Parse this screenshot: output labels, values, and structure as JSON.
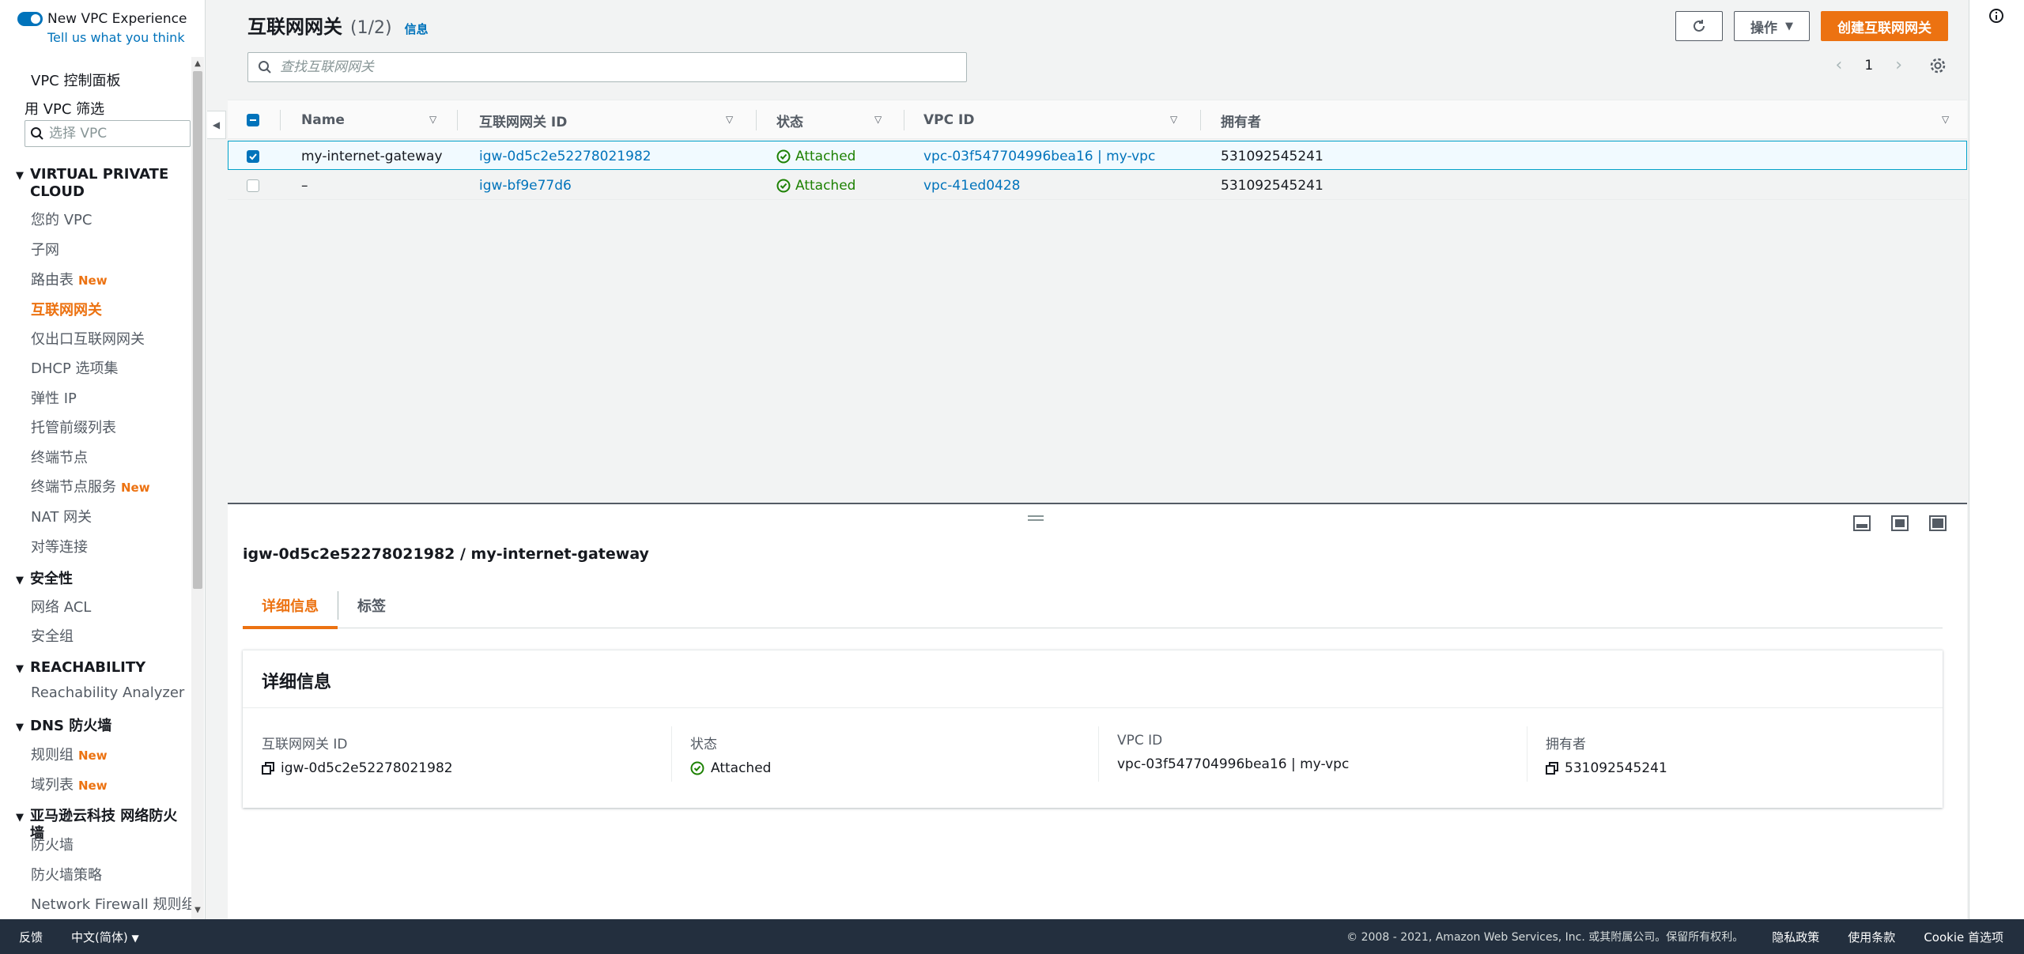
{
  "sidebar": {
    "experience_label": "New VPC Experience",
    "feedback_link": "Tell us what you think",
    "dashboard": "VPC 控制面板",
    "filter_label": "用 VPC 筛选",
    "filter_placeholder": "选择 VPC",
    "sections": {
      "vpc": "VIRTUAL PRIVATE CLOUD",
      "security": "安全性",
      "reachability": "REACHABILITY",
      "dns_firewall": "DNS 防火墙",
      "network_firewall": "亚马逊云科技 网络防火墙"
    },
    "items": {
      "your_vpcs": "您的 VPC",
      "subnets": "子网",
      "route_tables": "路由表",
      "internet_gateways": "互联网网关",
      "egress_only_gateways": "仅出口互联网网关",
      "dhcp_options": "DHCP 选项集",
      "elastic_ip": "弹性 IP",
      "prefix_lists": "托管前缀列表",
      "endpoints": "终端节点",
      "endpoint_services": "终端节点服务",
      "nat_gateways": "NAT 网关",
      "peering": "对等连接",
      "network_acl": "网络 ACL",
      "security_groups": "安全组",
      "reachability_analyzer": "Reachability Analyzer",
      "rule_groups": "规则组",
      "domain_lists": "域列表",
      "firewalls": "防火墙",
      "firewall_policies": "防火墙策略",
      "nf_rule_groups": "Network Firewall 规则组"
    },
    "new_badge": "New"
  },
  "header": {
    "title": "互联网网关",
    "count": "(1/2)",
    "info": "信息",
    "actions_label": "操作",
    "create_label": "创建互联网网关"
  },
  "search": {
    "placeholder": "查找互联网网关"
  },
  "pager": {
    "current": "1"
  },
  "table": {
    "columns": [
      "Name",
      "互联网网关 ID",
      "状态",
      "VPC ID",
      "拥有者"
    ],
    "rows": [
      {
        "name": "my-internet-gateway",
        "id": "igw-0d5c2e52278021982",
        "state": "Attached",
        "vpc": "vpc-03f547704996bea16 | my-vpc",
        "owner": "531092545241"
      },
      {
        "name": "–",
        "id": "igw-bf9e77d6",
        "state": "Attached",
        "vpc": "vpc-41ed0428",
        "owner": "531092545241"
      }
    ]
  },
  "detail": {
    "title": "igw-0d5c2e52278021982 / my-internet-gateway",
    "tabs": [
      "详细信息",
      "标签"
    ],
    "card_title": "详细信息",
    "fields": {
      "id_label": "互联网网关 ID",
      "id_value": "igw-0d5c2e52278021982",
      "state_label": "状态",
      "state_value": "Attached",
      "vpc_label": "VPC ID",
      "vpc_value": "vpc-03f547704996bea16 | my-vpc",
      "owner_label": "拥有者",
      "owner_value": "531092545241"
    }
  },
  "footer": {
    "feedback": "反馈",
    "language": "中文(简体)",
    "copyright": "© 2008 - 2021, Amazon Web Services, Inc. 或其附属公司。保留所有权利。",
    "privacy": "隐私政策",
    "terms": "使用条款",
    "cookies": "Cookie 首选项"
  },
  "colors": {
    "accent": "#ec7211",
    "link": "#0073bb",
    "success": "#1d8102",
    "footer_bg": "#232f3e"
  }
}
